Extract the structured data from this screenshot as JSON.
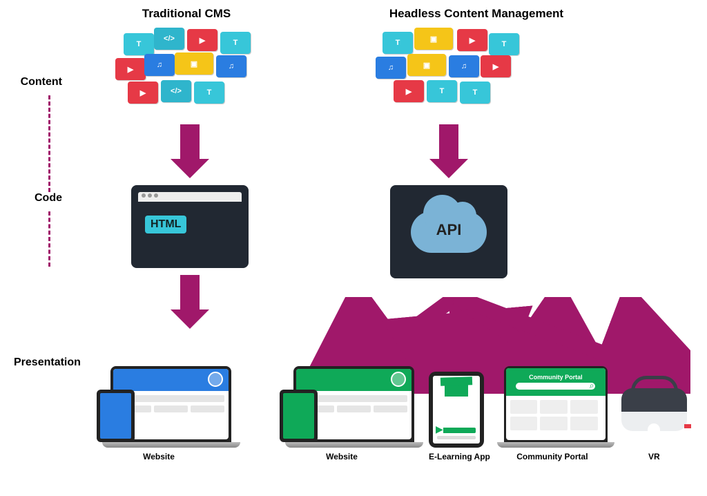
{
  "headers": {
    "left": "Traditional CMS",
    "right": "Headless Content Management"
  },
  "side_labels": {
    "content": "Content",
    "code": "Code",
    "presentation": "Presentation"
  },
  "html_badge": "HTML",
  "api_label": "API",
  "tile_text": "T",
  "tile_code": "</>",
  "tile_play": "▶",
  "tile_note": "♫",
  "tile_image": "▣",
  "portal_title": "Community Portal",
  "devices": {
    "website": "Website",
    "elearning": "E-Learning App",
    "portal": "Community Portal",
    "vr": "VR"
  }
}
